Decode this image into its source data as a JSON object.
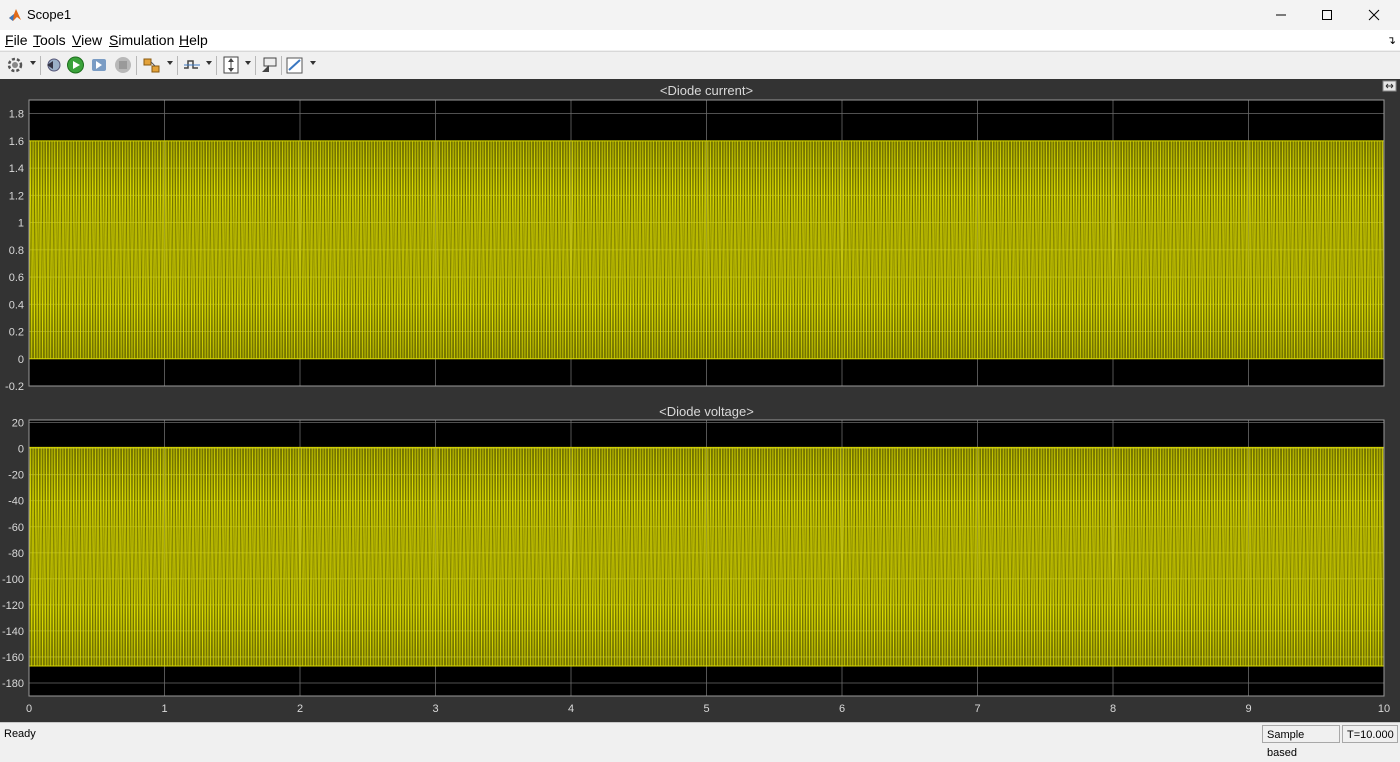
{
  "window": {
    "title": "Scope1"
  },
  "menu": [
    {
      "label": "File",
      "mnemonic": "F",
      "rest": "ile"
    },
    {
      "label": "Tools",
      "mnemonic": "T",
      "rest": "ools"
    },
    {
      "label": "View",
      "mnemonic": "V",
      "rest": "iew"
    },
    {
      "label": "Simulation",
      "mnemonic": "S",
      "rest": "imulation"
    },
    {
      "label": "Help",
      "mnemonic": "H",
      "rest": "elp"
    }
  ],
  "toolbar": {
    "icons": [
      "settings-icon",
      "step-back-icon",
      "run-icon",
      "step-forward-icon",
      "stop-icon",
      "highlight-block-icon",
      "triggers-icon",
      "autoscale-icon",
      "undock-scope-icon",
      "style-icon"
    ]
  },
  "status": {
    "ready": "Ready",
    "mode": "Sample based",
    "time": "T=10.000"
  },
  "colors": {
    "background": "#333333",
    "axes": "#000000",
    "grid": "#6b6b6b",
    "trace": "#d6d600",
    "text": "#d9d9d9"
  },
  "chart_data": [
    {
      "type": "line",
      "title": "<Diode current>",
      "xlabel": "",
      "ylabel": "",
      "xlim": [
        0,
        10
      ],
      "ylim": [
        -0.2,
        1.9
      ],
      "xticks": [
        0,
        1,
        2,
        3,
        4,
        5,
        6,
        7,
        8,
        9,
        10
      ],
      "yticks": [
        -0.2,
        0,
        0.2,
        0.4,
        0.6,
        0.8,
        1,
        1.2,
        1.4,
        1.6,
        1.8
      ],
      "ytick_labels": [
        "-0.2",
        "0",
        "0.2",
        "0.4",
        "0.6",
        "0.8",
        "1",
        "1.2",
        "1.4",
        "1.6",
        "1.8"
      ],
      "grid": true,
      "series": [
        {
          "min": 0,
          "max": 1.6,
          "frequency_hz": 50,
          "color": "#d6d600"
        }
      ]
    },
    {
      "type": "line",
      "title": "<Diode voltage>",
      "xlabel": "",
      "ylabel": "",
      "xlim": [
        0,
        10
      ],
      "ylim": [
        -190,
        22
      ],
      "xticks": [
        0,
        1,
        2,
        3,
        4,
        5,
        6,
        7,
        8,
        9,
        10
      ],
      "xtick_labels": [
        "0",
        "1",
        "2",
        "3",
        "4",
        "5",
        "6",
        "7",
        "8",
        "9",
        "10"
      ],
      "yticks": [
        -180,
        -160,
        -140,
        -120,
        -100,
        -80,
        -60,
        -40,
        -20,
        0,
        20
      ],
      "ytick_labels": [
        "-180",
        "-160",
        "-140",
        "-120",
        "-100",
        "-80",
        "-60",
        "-40",
        "-20",
        "0",
        "20"
      ],
      "grid": true,
      "series": [
        {
          "min": -167,
          "max": 1,
          "frequency_hz": 50,
          "color": "#d6d600"
        }
      ]
    }
  ]
}
